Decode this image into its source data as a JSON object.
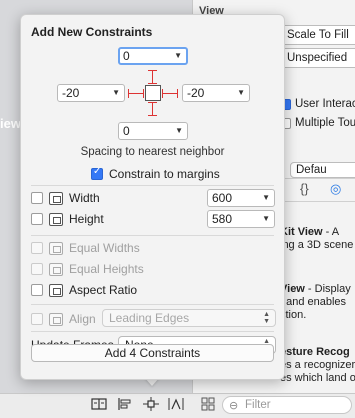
{
  "background": {
    "canvas_side_text": "iew",
    "inspector": {
      "header": "View",
      "content_mode": "Scale To Fill",
      "semantic": "Unspecified",
      "checkbox_user_interaction": "User Interac",
      "checkbox_multiple_touch": "Multiple Tou",
      "default_field": "Defau"
    },
    "library_tabs": [
      "{}",
      "◎"
    ],
    "library_items": [
      {
        "title": "Kit View",
        "desc_lines": [
          " - A",
          "ing a 3D scene"
        ]
      },
      {
        "title": "View",
        "desc_lines": [
          " - Display",
          "t and enables",
          "ction."
        ]
      },
      {
        "title": "esture Recog",
        "desc_lines": [
          "es a recognizer",
          "es which land o"
        ]
      }
    ],
    "filter_placeholder": "Filter"
  },
  "popover": {
    "title": "Add New Constraints",
    "spacing": {
      "top": "0",
      "left": "-20",
      "right": "-20",
      "bottom": "0"
    },
    "spacing_label": "Spacing to nearest neighbor",
    "constrain_to_margins": {
      "label": "Constrain to margins",
      "checked": true
    },
    "width": {
      "label": "Width",
      "value": "600",
      "checked": false
    },
    "height": {
      "label": "Height",
      "value": "580",
      "checked": false
    },
    "equal_widths": {
      "label": "Equal Widths",
      "enabled": false
    },
    "equal_heights": {
      "label": "Equal Heights",
      "enabled": false
    },
    "aspect_ratio": {
      "label": "Aspect Ratio",
      "checked": false
    },
    "align": {
      "label": "Align",
      "value": "Leading Edges",
      "enabled": false
    },
    "update_frames": {
      "label": "Update Frames",
      "value": "None"
    },
    "add_button": "Add 4 Constraints"
  },
  "colors": {
    "accent": "#3478f6",
    "strut": "#dd3333"
  }
}
